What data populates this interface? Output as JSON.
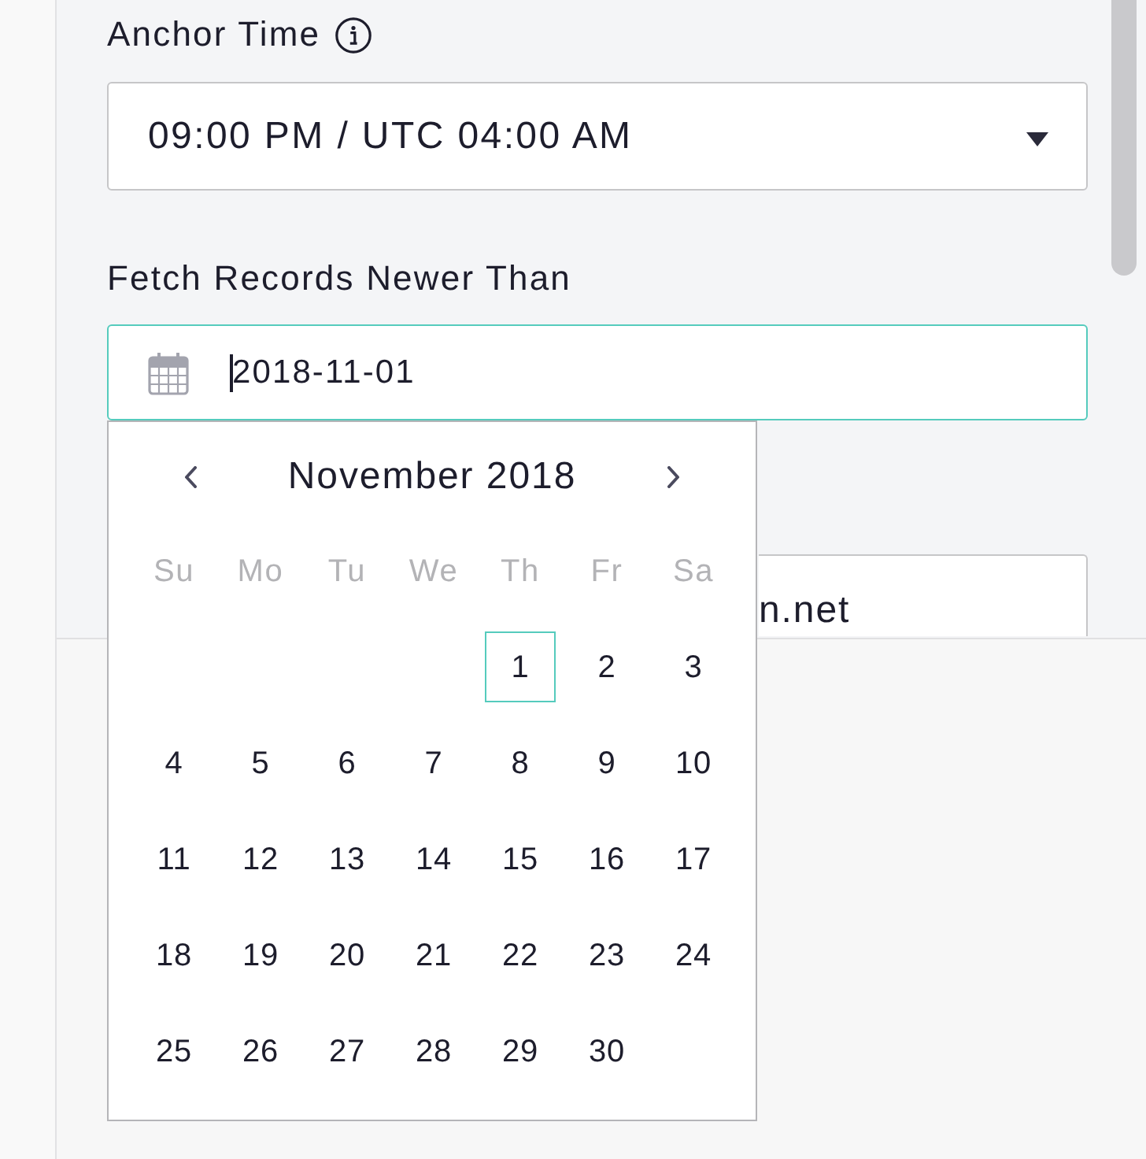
{
  "fields": [
    {
      "kind": "select",
      "label": "Anchor Time",
      "info_icon": true,
      "value": "09:00 PM / UTC 04:00 AM"
    },
    {
      "kind": "date",
      "label": "Fetch Records Newer Than",
      "value": "2018-11-01",
      "focused": true,
      "calendar": {
        "title": "November 2018",
        "weekdays": [
          "Su",
          "Mo",
          "Tu",
          "We",
          "Th",
          "Fr",
          "Sa"
        ],
        "weeks": [
          [
            {
              "day": "1",
              "selected": true
            },
            {
              "day": "2",
              "selected": false
            },
            {
              "day": "3",
              "selected": false
            }
          ],
          [
            {
              "day": "4",
              "selected": false
            },
            {
              "day": "5",
              "selected": false
            },
            {
              "day": "6",
              "selected": false
            },
            {
              "day": "7",
              "selected": false
            },
            {
              "day": "8",
              "selected": false
            },
            {
              "day": "9",
              "selected": false
            },
            {
              "day": "10",
              "selected": false
            }
          ],
          [
            {
              "day": "11",
              "selected": false
            },
            {
              "day": "12",
              "selected": false
            },
            {
              "day": "13",
              "selected": false
            },
            {
              "day": "14",
              "selected": false
            },
            {
              "day": "15",
              "selected": false
            },
            {
              "day": "16",
              "selected": false
            },
            {
              "day": "17",
              "selected": false
            }
          ],
          [
            {
              "day": "18",
              "selected": false
            },
            {
              "day": "19",
              "selected": false
            },
            {
              "day": "20",
              "selected": false
            },
            {
              "day": "21",
              "selected": false
            },
            {
              "day": "22",
              "selected": false
            },
            {
              "day": "23",
              "selected": false
            },
            {
              "day": "24",
              "selected": false
            }
          ],
          [
            {
              "day": "25",
              "selected": false
            },
            {
              "day": "26",
              "selected": false
            },
            {
              "day": "27",
              "selected": false
            },
            {
              "day": "28",
              "selected": false
            },
            {
              "day": "29",
              "selected": false
            },
            {
              "day": "30",
              "selected": false
            }
          ]
        ]
      }
    }
  ],
  "covered_field": {
    "value": "n.net"
  }
}
